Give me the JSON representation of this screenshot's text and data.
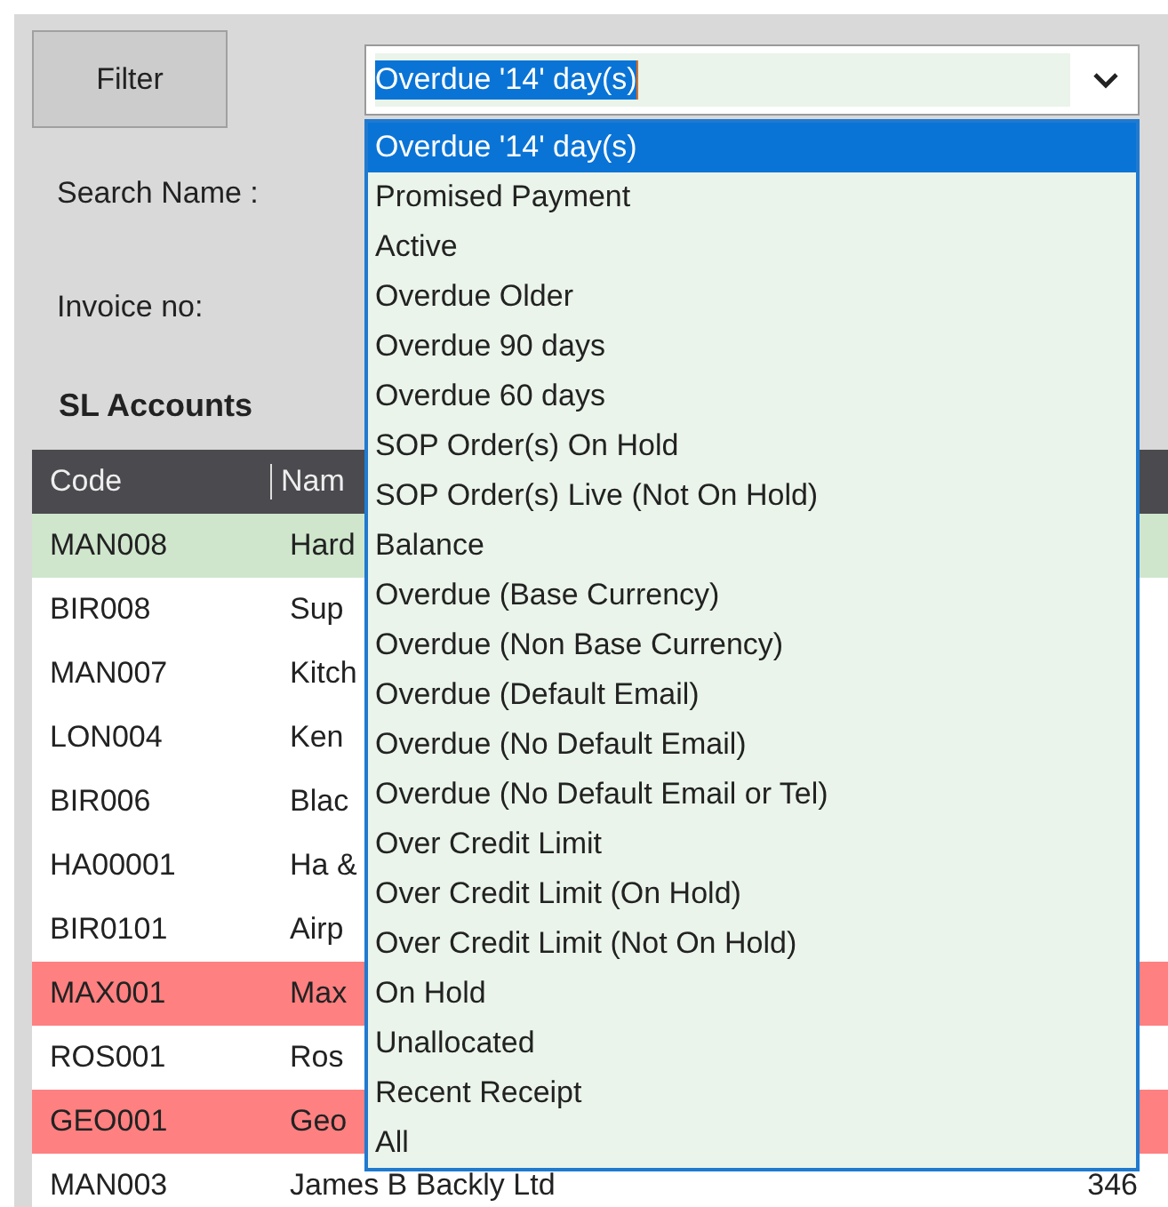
{
  "filter_button": {
    "label": "Filter"
  },
  "combo": {
    "value": "Overdue '14' day(s)",
    "options": [
      {
        "label": "Overdue '14' day(s)",
        "selected": true
      },
      {
        "label": "Promised Payment",
        "selected": false
      },
      {
        "label": "Active",
        "selected": false
      },
      {
        "label": "Overdue Older",
        "selected": false
      },
      {
        "label": "Overdue 90 days",
        "selected": false
      },
      {
        "label": "Overdue 60 days",
        "selected": false
      },
      {
        "label": "SOP Order(s) On Hold",
        "selected": false
      },
      {
        "label": "SOP Order(s) Live (Not On Hold)",
        "selected": false
      },
      {
        "label": "Balance",
        "selected": false
      },
      {
        "label": "Overdue (Base Currency)",
        "selected": false
      },
      {
        "label": "Overdue (Non Base Currency)",
        "selected": false
      },
      {
        "label": "Overdue (Default Email)",
        "selected": false
      },
      {
        "label": "Overdue (No Default Email)",
        "selected": false
      },
      {
        "label": "Overdue (No Default Email or Tel)",
        "selected": false
      },
      {
        "label": "Over Credit Limit",
        "selected": false
      },
      {
        "label": "Over Credit Limit (On Hold)",
        "selected": false
      },
      {
        "label": "Over Credit Limit (Not On Hold)",
        "selected": false
      },
      {
        "label": "On Hold",
        "selected": false
      },
      {
        "label": "Unallocated",
        "selected": false
      },
      {
        "label": "Recent Receipt",
        "selected": false
      },
      {
        "label": "All",
        "selected": false
      }
    ]
  },
  "search_name": {
    "label": "Search Name :"
  },
  "invoice_no": {
    "label": "Invoice no:"
  },
  "section_title": "SL Accounts",
  "table": {
    "columns": [
      "Code",
      "Nam"
    ],
    "rows": [
      {
        "cells": [
          "MAN008",
          "Hard"
        ],
        "color": "#cfe6cc"
      },
      {
        "cells": [
          "BIR008",
          "Sup"
        ],
        "color": "#ffffff"
      },
      {
        "cells": [
          "MAN007",
          "Kitch"
        ],
        "color": "#ffffff"
      },
      {
        "cells": [
          "LON004",
          "Ken"
        ],
        "color": "#ffffff"
      },
      {
        "cells": [
          "BIR006",
          "Blac"
        ],
        "color": "#ffffff"
      },
      {
        "cells": [
          "HA00001",
          "Ha &"
        ],
        "color": "#ffffff"
      },
      {
        "cells": [
          "BIR0101",
          "Airp"
        ],
        "color": "#ffffff"
      },
      {
        "cells": [
          "MAX001",
          "Max"
        ],
        "color": "#ff8080"
      },
      {
        "cells": [
          "ROS001",
          "Ros"
        ],
        "color": "#ffffff"
      },
      {
        "cells": [
          "GEO001",
          "Geo"
        ],
        "color": "#ff8080"
      },
      {
        "cells": [
          "MAN003",
          "James B Backly Ltd",
          "346"
        ],
        "color": "#ffffff"
      }
    ]
  }
}
